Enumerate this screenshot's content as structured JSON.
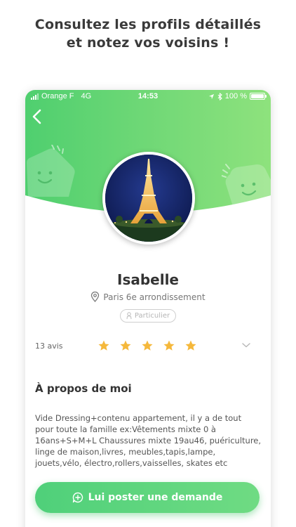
{
  "headline": {
    "line1": "Consultez les profils détaillés",
    "line2": "et notez vos voisins !"
  },
  "status_bar": {
    "carrier": "Orange F",
    "network": "4G",
    "time": "14:53",
    "battery": "100 %"
  },
  "profile": {
    "name": "Isabelle",
    "location": "Paris 6e arrondissement",
    "badge": "Particulier",
    "reviews_count": "13 avis",
    "rating": 5,
    "rating_max": 5
  },
  "about": {
    "title": "À propos de moi",
    "text": "Vide Dressing+contenu appartement, il y a de tout pour toute la famille ex:Vêtements mixte 0 à 16ans+S+M+L Chaussures mixte 19au46, puériculture, linge de maison,livres, meubles,tapis,lampe, jouets,vélo, électro,rollers,vaisselles, skates etc"
  },
  "cta": {
    "label": "Lui poster une demande"
  },
  "icons": {
    "back": "chevron-left-icon",
    "location": "location-pin-icon",
    "badge": "user-icon",
    "star": "star-icon",
    "expand": "chevron-down-icon",
    "cta": "chat-plus-icon"
  },
  "colors": {
    "brand_green": "#5fd37a",
    "star": "#f5b83b",
    "text_dark": "#333333"
  }
}
